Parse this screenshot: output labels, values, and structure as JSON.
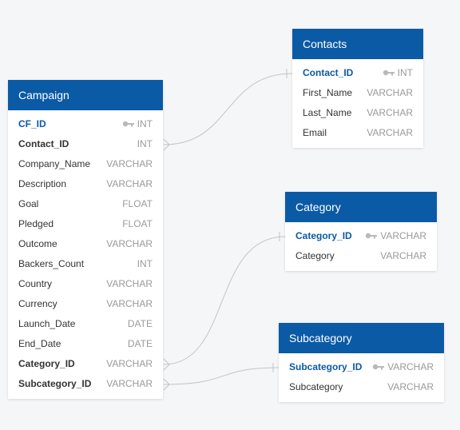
{
  "colors": {
    "background": "#f5f6f7",
    "header": "#0b5aa6",
    "primary_key_text": "#0b5aa6",
    "type_text": "#9a9a9a",
    "connector": "#c4c4c4"
  },
  "tables": {
    "campaign": {
      "title": "Campaign",
      "columns": [
        {
          "name": "CF_ID",
          "type": "INT",
          "icon": "key-icon"
        },
        {
          "name": "Contact_ID",
          "type": "INT"
        },
        {
          "name": "Company_Name",
          "type": "VARCHAR"
        },
        {
          "name": "Description",
          "type": "VARCHAR"
        },
        {
          "name": "Goal",
          "type": "FLOAT"
        },
        {
          "name": "Pledged",
          "type": "FLOAT"
        },
        {
          "name": "Outcome",
          "type": "VARCHAR"
        },
        {
          "name": "Backers_Count",
          "type": "INT"
        },
        {
          "name": "Country",
          "type": "VARCHAR"
        },
        {
          "name": "Currency",
          "type": "VARCHAR"
        },
        {
          "name": "Launch_Date",
          "type": "DATE"
        },
        {
          "name": "End_Date",
          "type": "DATE"
        },
        {
          "name": "Category_ID",
          "type": "VARCHAR"
        },
        {
          "name": "Subcategory_ID",
          "type": "VARCHAR"
        }
      ]
    },
    "contacts": {
      "title": "Contacts",
      "columns": [
        {
          "name": "Contact_ID",
          "type": "INT",
          "icon": "key-icon"
        },
        {
          "name": "First_Name",
          "type": "VARCHAR"
        },
        {
          "name": "Last_Name",
          "type": "VARCHAR"
        },
        {
          "name": "Email",
          "type": "VARCHAR"
        }
      ]
    },
    "category": {
      "title": "Category",
      "columns": [
        {
          "name": "Category_ID",
          "type": "VARCHAR",
          "icon": "key-icon"
        },
        {
          "name": "Category",
          "type": "VARCHAR"
        }
      ]
    },
    "subcategory": {
      "title": "Subcategory",
      "columns": [
        {
          "name": "Subcategory_ID",
          "type": "VARCHAR",
          "icon": "key-icon"
        },
        {
          "name": "Subcategory",
          "type": "VARCHAR"
        }
      ]
    }
  }
}
